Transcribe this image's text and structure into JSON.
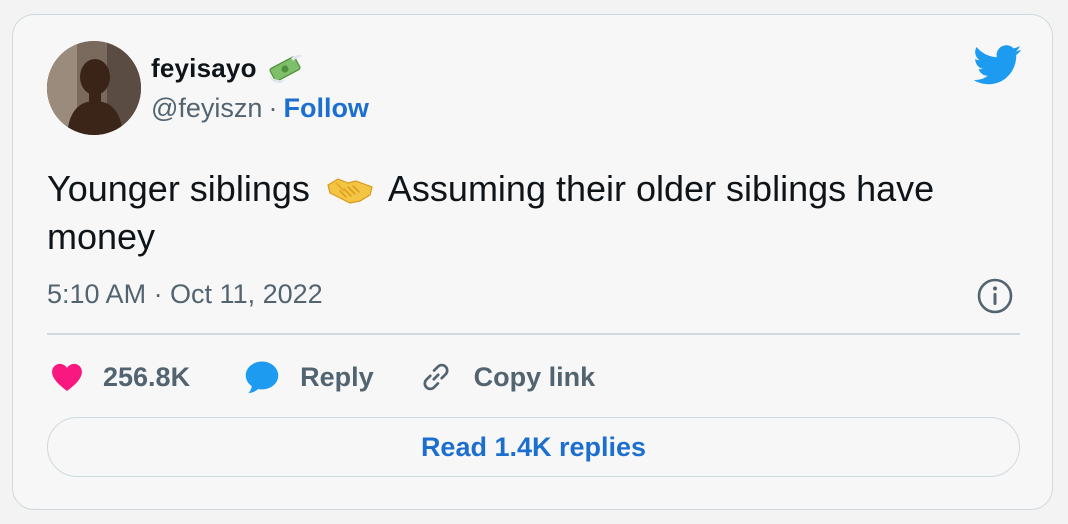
{
  "author": {
    "display_name": "feyisayo",
    "name_emoji": "money-with-wings",
    "handle": "@feyiszn",
    "separator": "·",
    "follow_label": "Follow"
  },
  "tweet": {
    "text_before_emoji": "Younger siblings",
    "emoji": "handshake",
    "text_after_emoji": "Assuming their older siblings have money",
    "timestamp": "5:10 AM · Oct 11, 2022"
  },
  "actions": {
    "like_count": "256.8K",
    "reply_label": "Reply",
    "copy_link_label": "Copy link"
  },
  "read_replies_label": "Read 1.4K replies",
  "colors": {
    "twitter_blue": "#1d9bf0",
    "link_blue": "#1d6fcf",
    "like_pink": "#f91880",
    "text_primary": "#0f1419",
    "text_secondary": "#536471",
    "border": "#cfd9de"
  }
}
